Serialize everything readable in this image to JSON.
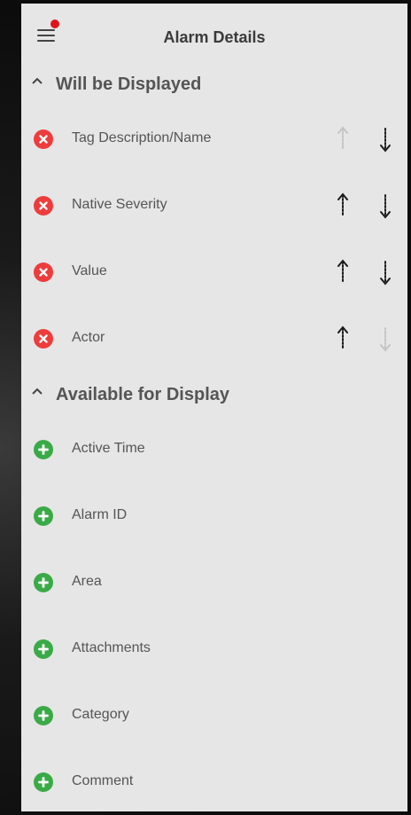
{
  "header": {
    "title": "Alarm Details"
  },
  "displayed": {
    "heading": "Will be Displayed",
    "items": [
      {
        "label": "Tag Description/Name",
        "up_enabled": false,
        "down_enabled": true
      },
      {
        "label": "Native Severity",
        "up_enabled": true,
        "down_enabled": true
      },
      {
        "label": "Value",
        "up_enabled": true,
        "down_enabled": true
      },
      {
        "label": "Actor",
        "up_enabled": true,
        "down_enabled": false
      }
    ]
  },
  "available": {
    "heading": "Available for Display",
    "items": [
      {
        "label": "Active Time"
      },
      {
        "label": "Alarm ID"
      },
      {
        "label": "Area"
      },
      {
        "label": "Attachments"
      },
      {
        "label": "Category"
      },
      {
        "label": "Comment"
      }
    ]
  },
  "colors": {
    "remove": "#ee3c3c",
    "add": "#3aaa47",
    "arrow_enabled": "#1a1a1a",
    "arrow_disabled": "#c4c4c4"
  },
  "icons": {
    "menu": "hamburger-icon",
    "notification": "notification-dot",
    "collapse": "chevron-up-icon",
    "remove": "remove-circle-icon",
    "add": "add-circle-icon",
    "move_up": "arrow-up-icon",
    "move_down": "arrow-down-icon"
  }
}
